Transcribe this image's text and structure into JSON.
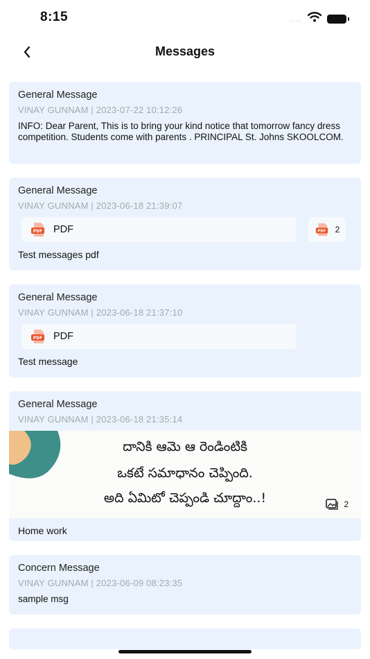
{
  "status_bar": {
    "time": "8:15",
    "signal": "....",
    "wifi_icon": "wifi-icon",
    "battery_icon": "battery-icon"
  },
  "nav": {
    "back_icon": "chevron-left-icon",
    "title": "Messages"
  },
  "messages": [
    {
      "type": "General Message",
      "meta": "VINAY GUNNAM | 2023-07-22 10:12:26",
      "body": "INFO: Dear Parent, This is to bring your kind notice that tomorrow fancy dress competition. Students come with parents .  PRINCIPAL St. Johns SKOOLCOM."
    },
    {
      "type": "General Message",
      "meta": "VINAY GUNNAM | 2023-06-18 21:39:07",
      "attachment_label": "PDF",
      "attachment_count": "2",
      "caption": "Test messages pdf"
    },
    {
      "type": "General Message",
      "meta": "VINAY GUNNAM | 2023-06-18 21:37:10",
      "attachment_label": "PDF",
      "caption": "Test message"
    },
    {
      "type": "General Message",
      "meta": "VINAY GUNNAM | 2023-06-18 21:35:14",
      "image_lines": [
        "దానికి ఆమె ఆ రెండింటికి",
        "ఒకటే సమాధానం చెప్పింది.",
        "అది ఏమిటో చెప్పండి చూద్దాం..!"
      ],
      "image_count": "2",
      "caption": "Home work"
    },
    {
      "type": "Concern Message",
      "meta": "VINAY GUNNAM | 2023-06-09 08:23:35",
      "body": "sample msg"
    }
  ],
  "colors": {
    "card_bg": "#eaf3fd",
    "meta_text": "#a5a8ad",
    "pdf_red": "#e9542f"
  }
}
